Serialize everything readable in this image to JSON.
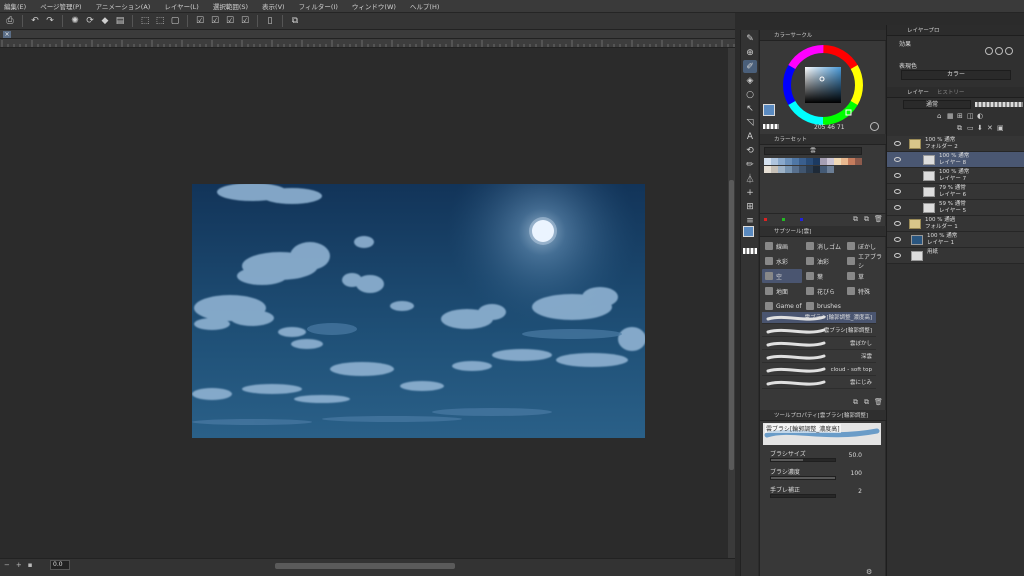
{
  "menu": [
    "編集(E)",
    "ページ管理(P)",
    "アニメーション(A)",
    "レイヤー(L)",
    "選択範囲(S)",
    "表示(V)",
    "フィルター(I)",
    "ウィンドウ(W)",
    "ヘルプ(H)"
  ],
  "canvas": {
    "tab_close": "×",
    "zoom": "0.0"
  },
  "color_wheel": {
    "title": "カラーサークル",
    "readout": "205 46 71",
    "main_color": "#5a8ac0"
  },
  "color_set": {
    "title": "カラーセット",
    "set_name": "雲"
  },
  "sub_tool": {
    "title": "サブツール[雲]",
    "items": [
      {
        "label": "線画"
      },
      {
        "label": "消しゴム"
      },
      {
        "label": "ぼかし"
      },
      {
        "label": "水彩"
      },
      {
        "label": "油彩"
      },
      {
        "label": "エアブラシ"
      },
      {
        "label": "空",
        "selected": true
      },
      {
        "label": "葉"
      },
      {
        "label": "草"
      },
      {
        "label": "地面"
      },
      {
        "label": "花びら"
      },
      {
        "label": "特殊"
      },
      {
        "label": "Game of"
      },
      {
        "label": "brushes"
      }
    ],
    "strokes": [
      "雲ブラシ[輪郭調整_濃度高]",
      "雲ブラシ[輪郭調整]",
      "雲ぼかし",
      "深雲",
      "cloud - soft top",
      "雲にじみ"
    ]
  },
  "tool_property": {
    "title": "ツールプロパティ[雲ブラシ[輪郭調整]",
    "brush_name": "雲ブラシ[輪郭調整_濃度高]",
    "size_label": "ブラシサイズ",
    "size_value": "50.0",
    "size_fraction": 0.5,
    "density_label": "ブラシ濃度",
    "density_value": "100",
    "density_fraction": 1.0,
    "stabilize_label": "手ブレ補正",
    "stabilize_value": "2"
  },
  "right_panel": {
    "effect_tab": "レイヤープロ",
    "effect_label": "効果",
    "display_color_label": "表現色",
    "display_color_value": "カラー",
    "layer_tab": "レイヤー",
    "layer_tab2": "ヒストリー",
    "blend_mode": "通常",
    "layers": [
      {
        "line1": "100 % 通常",
        "line2": "フォルダー 2",
        "type": "folder"
      },
      {
        "line1": "100 % 通常",
        "line2": "レイヤー 8",
        "type": "layer",
        "selected": true
      },
      {
        "line1": "100 % 通常",
        "line2": "レイヤー 7",
        "type": "layer"
      },
      {
        "line1": "79 % 通常",
        "line2": "レイヤー 6",
        "type": "layer"
      },
      {
        "line1": "59 % 通常",
        "line2": "レイヤー 5",
        "type": "layer"
      },
      {
        "line1": "100 % 通過",
        "line2": "フォルダー 1",
        "type": "folder"
      },
      {
        "line1": "100 % 通常",
        "line2": "レイヤー 1",
        "type": "layer"
      },
      {
        "line1": "",
        "line2": "用紙",
        "type": "paper"
      }
    ]
  }
}
